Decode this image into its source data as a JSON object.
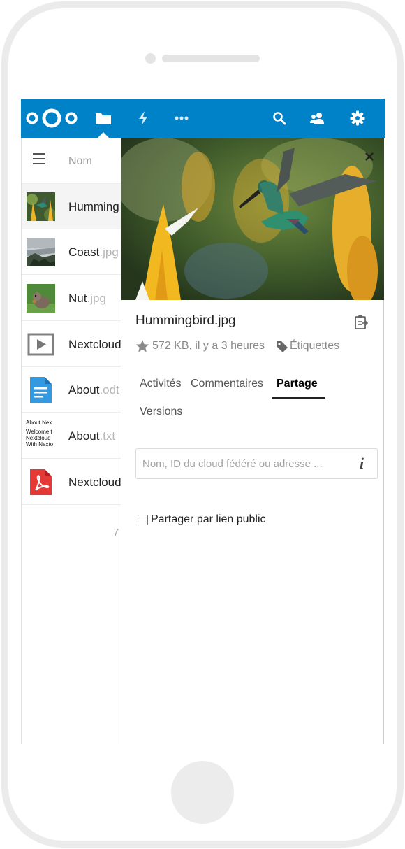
{
  "header": {
    "logo_icon": "nextcloud-logo",
    "nav_icons": [
      "folder-icon",
      "lightning-icon",
      "more-icon"
    ],
    "actions_icons": [
      "search-icon",
      "contacts-icon",
      "gear-icon"
    ],
    "color": "#0082c9"
  },
  "filelist": {
    "menu_icon": "hamburger-icon",
    "column_name": "Nom",
    "files": [
      {
        "name": "Humming",
        "ext": "",
        "thumb": "hummingbird-thumbnail"
      },
      {
        "name": "Coast",
        "ext": ".jpg",
        "thumb": "coast-thumbnail"
      },
      {
        "name": "Nut",
        "ext": ".jpg",
        "thumb": "squirrel-thumbnail"
      },
      {
        "name": "Nextcloud",
        "ext": "",
        "thumb": "video-icon"
      },
      {
        "name": "About",
        "ext": ".odt",
        "thumb": "document-icon"
      },
      {
        "name": "About",
        "ext": ".txt",
        "thumb": "text-preview"
      },
      {
        "name": "Nextcloud",
        "ext": "",
        "thumb": "pdf-icon"
      }
    ],
    "txt_preview_lines": [
      "About Nex",
      "Welcome t",
      "Nextcloud",
      "With Nexto"
    ],
    "count": "7"
  },
  "sidebar": {
    "filename": "Hummingbird.jpg",
    "size": "572 KB, il y a 3 heures",
    "tags": "Étiquettes",
    "tabs": {
      "activites": "Activités",
      "commentaires": "Commentaires",
      "partage": "Partage",
      "versions": "Versions"
    },
    "active_tab": "Partage",
    "share_placeholder": "Nom, ID du cloud fédéré ou adresse ...",
    "info_label": "i",
    "public_link_label": "Partager par lien public",
    "public_link_checked": false
  }
}
